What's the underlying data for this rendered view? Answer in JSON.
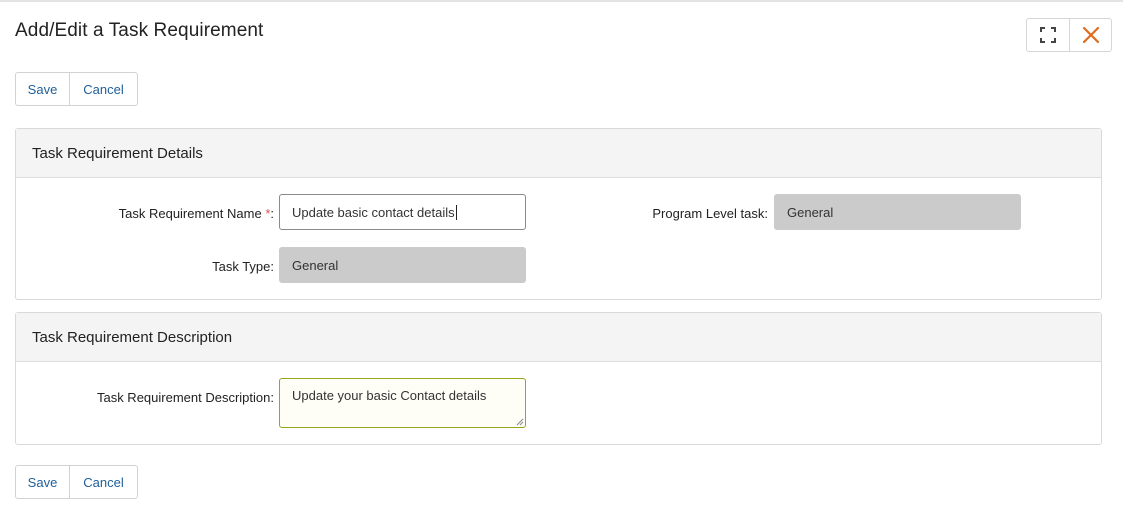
{
  "dialog": {
    "title": "Add/Edit a Task Requirement",
    "window_buttons": {
      "maximize_icon": "expand-icon",
      "close_icon": "close-icon",
      "close_color": "#e06b1f"
    }
  },
  "toolbar_top": {
    "save_label": "Save",
    "cancel_label": "Cancel"
  },
  "details_panel": {
    "heading": "Task Requirement Details",
    "name_label": "Task Requirement Name",
    "required_marker": "*",
    "name_suffix": ":",
    "name_value": "Update basic contact details",
    "program_level_label": "Program Level task:",
    "program_level_value": "General",
    "task_type_label": "Task Type:",
    "task_type_value": "General"
  },
  "description_panel": {
    "heading": "Task Requirement Description",
    "description_label": "Task Requirement Description:",
    "description_value": "Update your basic Contact details"
  },
  "toolbar_bottom": {
    "save_label": "Save",
    "cancel_label": "Cancel"
  },
  "colors": {
    "link": "#1f5f99",
    "required": "#d9534f",
    "readonly_bg": "#cbcbcb",
    "textarea_border": "#93a81c"
  }
}
